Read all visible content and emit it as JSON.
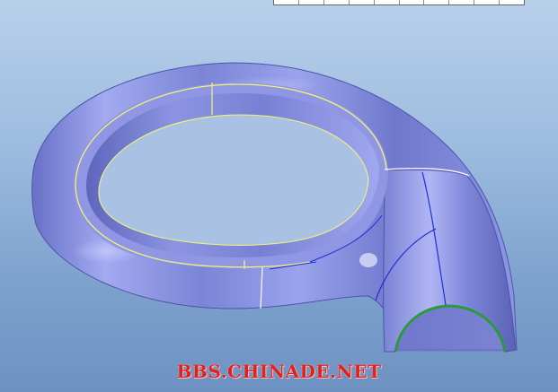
{
  "watermark": {
    "text": "BBS.CHINADE.NET"
  },
  "colors": {
    "background_top": "#b8d0ea",
    "background_bottom": "#6d92c2",
    "surface": "#8f98e0",
    "surface_shadow": "#5c63b5",
    "edge_yellow": "#f2f27a",
    "edge_white": "#f4f4ff",
    "edge_blue": "#1c2fd6",
    "edge_green": "#2a9a3a",
    "watermark": "#e0221f"
  },
  "icons": {
    "toolbar_strip": "table-strip"
  }
}
